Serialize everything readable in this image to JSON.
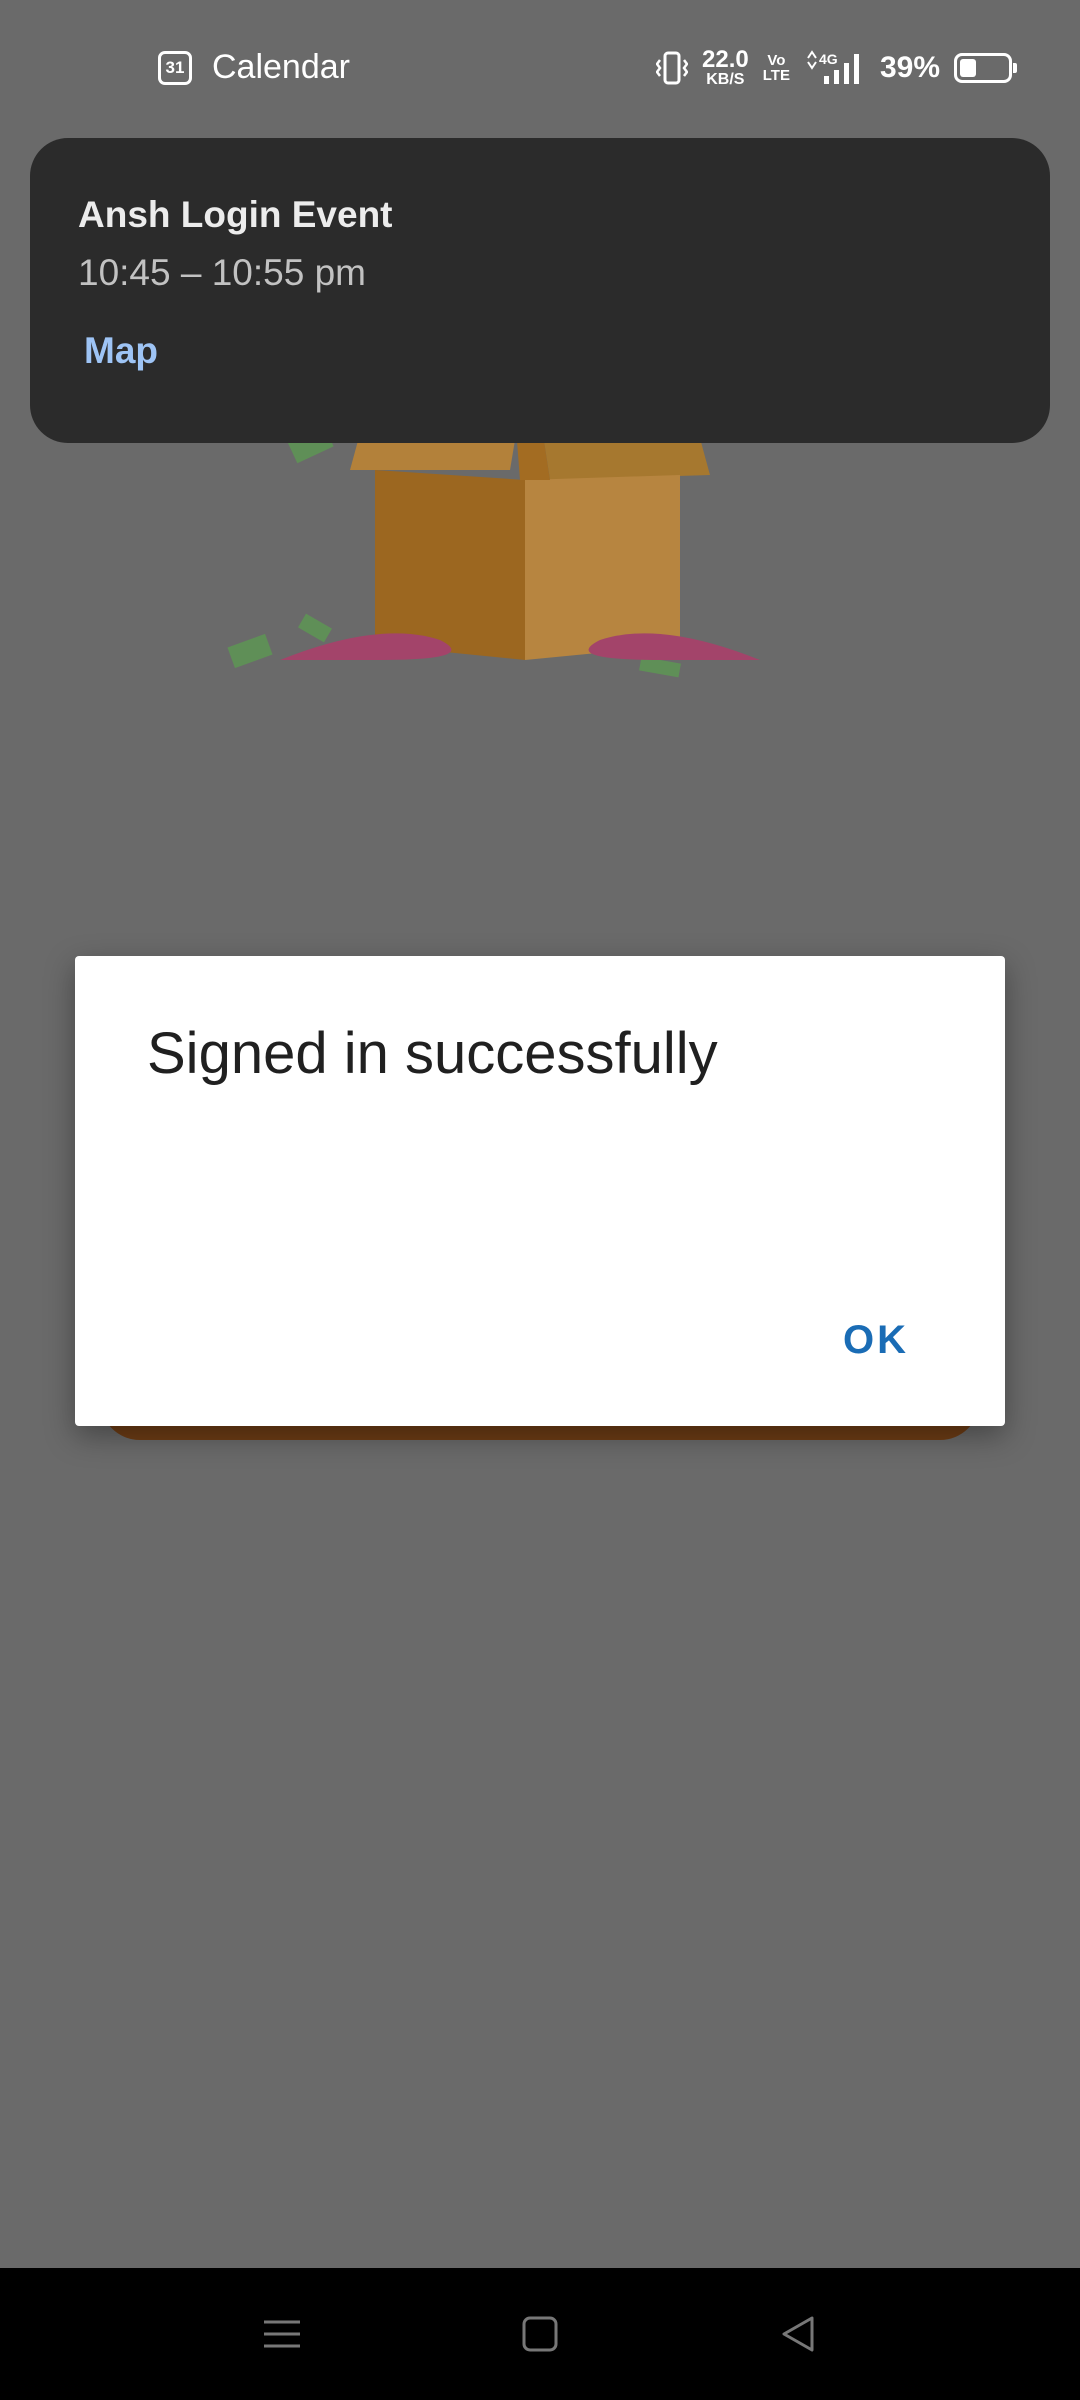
{
  "status_bar": {
    "app_name": "Calendar",
    "calendar_day": "31",
    "network_speed": "22.0",
    "network_speed_unit": "KB/S",
    "volte_top": "Vo",
    "volte_bottom": "LTE",
    "network_type": "4G",
    "battery_percent": "39%",
    "battery_level": 0.39,
    "icons": [
      "calendar-icon",
      "vibrate-icon",
      "volte-icon",
      "signal-icon",
      "battery-icon"
    ]
  },
  "notification": {
    "title": "Ansh Login Event",
    "time": "10:45 – 10:55 pm",
    "action_label": "Map"
  },
  "dialog": {
    "title": "Signed in successfully",
    "ok_label": "OK"
  },
  "nav_bar": {
    "icons": [
      "menu-icon",
      "home-icon",
      "back-icon"
    ]
  },
  "colors": {
    "scrim": "#6a6a6a",
    "notification_bg": "#2b2b2b",
    "notification_action": "#9ec4f5",
    "dialog_button": "#1a6cb5",
    "nav_bar_bg": "#000000"
  }
}
